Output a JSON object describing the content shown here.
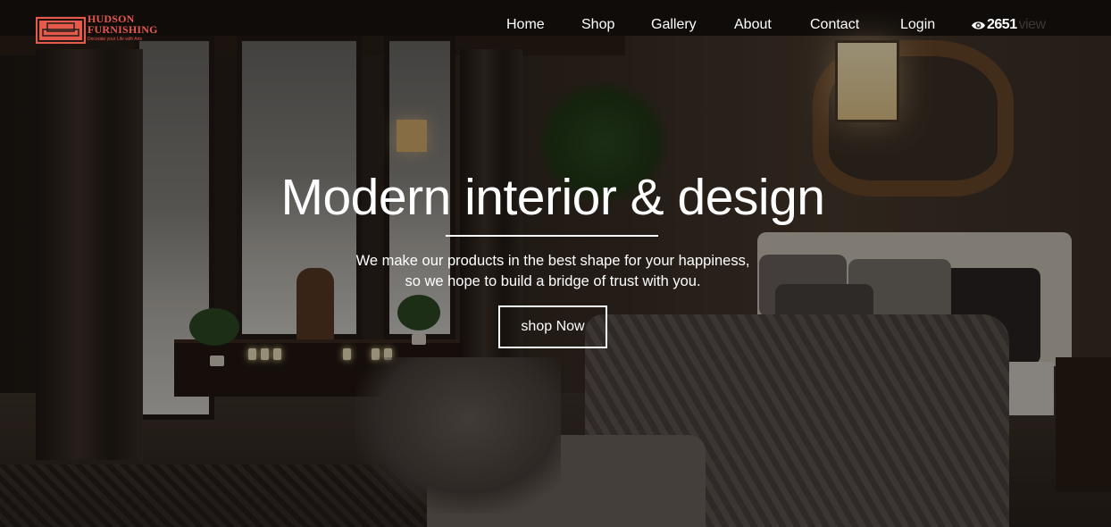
{
  "brand": {
    "name_line1": "HUDSON",
    "name_line2": "FURNISHING",
    "tagline": "Decorate your Life with Arts",
    "accent_color": "#e55a4a",
    "icon": "sofa-icon"
  },
  "nav": {
    "items": [
      {
        "label": "Home"
      },
      {
        "label": "Shop"
      },
      {
        "label": "Gallery"
      },
      {
        "label": "About"
      },
      {
        "label": "Contact"
      },
      {
        "label": "Login"
      }
    ]
  },
  "views": {
    "icon": "eye-icon",
    "count": "2651",
    "suffix": "view"
  },
  "hero": {
    "title": "Modern interior & design",
    "subtitle_line1": "We make our products in the best shape for your happiness,",
    "subtitle_line2": "so we hope to build a bridge of trust with you.",
    "cta_label": "shop Now"
  }
}
